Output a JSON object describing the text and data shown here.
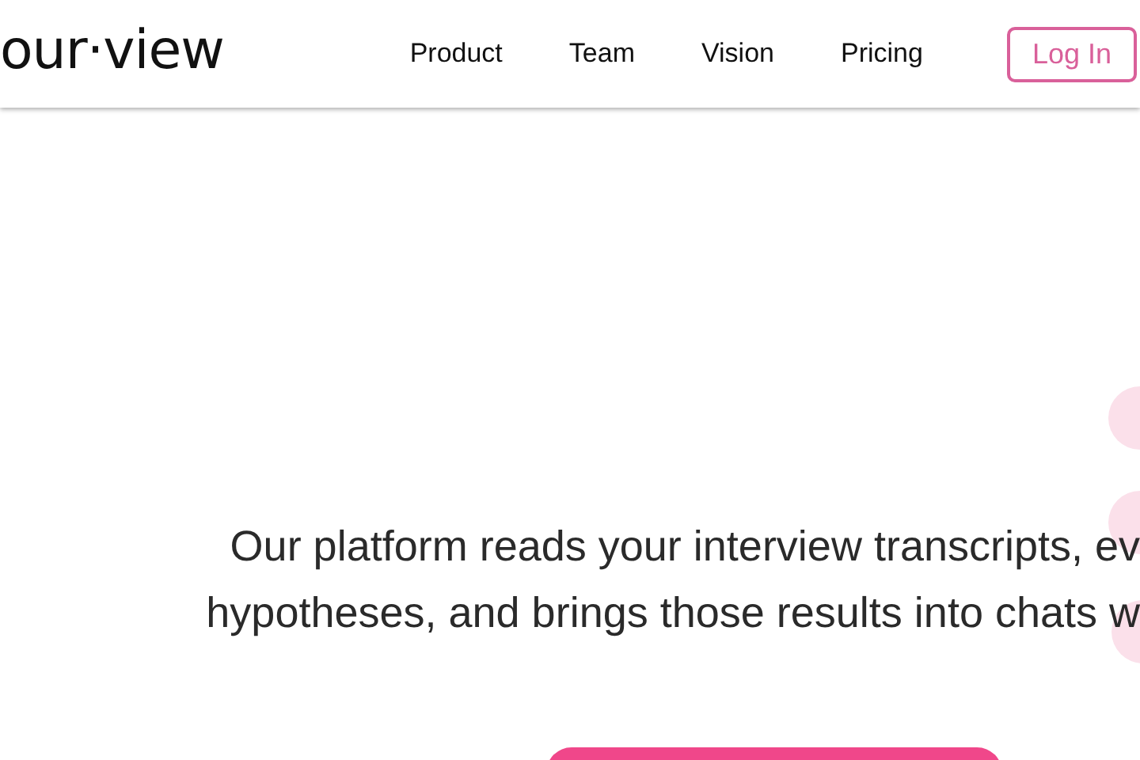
{
  "header": {
    "logo": "our·view",
    "nav": [
      {
        "label": "Product"
      },
      {
        "label": "Team"
      },
      {
        "label": "Vision"
      },
      {
        "label": "Pricing"
      }
    ],
    "login": "Log In"
  },
  "hero": {
    "lines": [
      "Our platform reads your interview transcripts, ev",
      "hypotheses, and brings those results into chats w"
    ]
  }
}
